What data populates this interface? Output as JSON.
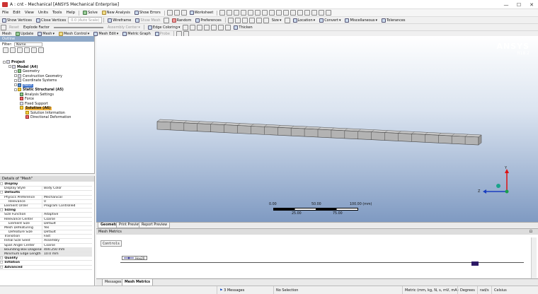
{
  "window": {
    "title": "A : cnt - Mechanical [ANSYS Mechanical Enterprise]",
    "controls": [
      "—",
      "☐",
      "✕"
    ]
  },
  "menu": [
    "File",
    "Edit",
    "View",
    "Units",
    "Tools",
    "Help"
  ],
  "toolbar1": {
    "solve": "Solve",
    "new_analysis": "New Analysis",
    "show_errors": "Show Errors",
    "worksheet": "Worksheet"
  },
  "toolbar2": {
    "show_vertices": "Show Vertices",
    "close_vertices": "Close Vertices",
    "auto_scale": "0.0 (Auto Scale)",
    "wireframe": "Wireframe",
    "show_mesh": "Show Mesh",
    "random": "Random",
    "preferences": "Preferences",
    "size": "Size",
    "location": "Location",
    "convert": "Convert",
    "miscellaneous": "Miscellaneous",
    "tolerances": "Tolerances"
  },
  "toolbar3": {
    "reset": "Reset",
    "explode_factor": "Explode Factor",
    "assembly_center": "Assembly Center",
    "edge_coloring": "Edge Coloring",
    "thicken": "Thicken"
  },
  "toolbar4": {
    "mesh_tab": "Mesh",
    "update": "Update",
    "mesh": "Mesh",
    "mesh_control": "Mesh Control",
    "mesh_edit": "Mesh Edit",
    "metric_graph": "Metric Graph",
    "probe": "Probe"
  },
  "outline": {
    "title": "Outline",
    "filter_label": "Filter:",
    "filter_value": "Name",
    "tree": [
      {
        "label": "Project",
        "level": 0,
        "icon": "project-icon",
        "bold": true
      },
      {
        "label": "Model (A4)",
        "level": 1,
        "icon": "model-icon",
        "bold": true
      },
      {
        "label": "Geometry",
        "level": 2,
        "icon": "geometry-icon",
        "bold": false
      },
      {
        "label": "Construction Geometry",
        "level": 2,
        "icon": "construction-geometry-icon",
        "bold": false
      },
      {
        "label": "Coordinate Systems",
        "level": 2,
        "icon": "coordinate-systems-icon",
        "bold": false
      },
      {
        "label": "Mesh",
        "level": 2,
        "icon": "mesh-icon",
        "bold": false,
        "selected": true
      },
      {
        "label": "Static Structural (A5)",
        "level": 2,
        "icon": "static-structural-icon",
        "bold": true
      },
      {
        "label": "Analysis Settings",
        "level": 3,
        "icon": "analysis-settings-icon",
        "bold": false
      },
      {
        "label": "Force",
        "level": 3,
        "icon": "force-icon",
        "bold": false
      },
      {
        "label": "Fixed Support",
        "level": 3,
        "icon": "fixed-support-icon",
        "bold": false
      },
      {
        "label": "Solution (A6)",
        "level": 3,
        "icon": "solution-icon",
        "bold": true,
        "highlight": true
      },
      {
        "label": "Solution Information",
        "level": 4,
        "icon": "solution-information-icon",
        "bold": false
      },
      {
        "label": "Directional Deformation",
        "level": 4,
        "icon": "directional-deformation-icon",
        "bold": false
      }
    ]
  },
  "details": {
    "title": "Details of \"Mesh\"",
    "rows": [
      {
        "k": "Display",
        "v": "",
        "type": "sec"
      },
      {
        "k": "Display Style",
        "v": "Body Color",
        "type": ""
      },
      {
        "k": "Defaults",
        "v": "",
        "type": "sec"
      },
      {
        "k": "Physics Preference",
        "v": "Mechanical",
        "type": ""
      },
      {
        "k": "Relevance",
        "v": "0",
        "type": "ind"
      },
      {
        "k": "Element Order",
        "v": "Program Controlled",
        "type": ""
      },
      {
        "k": "Sizing",
        "v": "",
        "type": "sec"
      },
      {
        "k": "Size Function",
        "v": "Adaptive",
        "type": ""
      },
      {
        "k": "Relevance Center",
        "v": "Coarse",
        "type": ""
      },
      {
        "k": "Element Size",
        "v": "Default",
        "type": "ind"
      },
      {
        "k": "Mesh Defeaturing",
        "v": "Yes",
        "type": ""
      },
      {
        "k": "Defeature Size",
        "v": "Default",
        "type": "ind"
      },
      {
        "k": "Transition",
        "v": "Fast",
        "type": ""
      },
      {
        "k": "Initial Size Seed",
        "v": "Assembly",
        "type": ""
      },
      {
        "k": "Span Angle Center",
        "v": "Coarse",
        "type": ""
      },
      {
        "k": "Bounding Box Diagonal",
        "v": "400.250 mm",
        "type": "hl"
      },
      {
        "k": "Minimum Edge Length",
        "v": "10.0 mm",
        "type": "hl"
      },
      {
        "k": "Quality",
        "v": "",
        "type": "sec"
      },
      {
        "k": "Inflation",
        "v": "",
        "type": "sec"
      },
      {
        "k": "Advanced",
        "v": "",
        "type": "sec"
      }
    ]
  },
  "viewport": {
    "logo": "ANSYS",
    "version": "R18.2",
    "scale": {
      "top": [
        "0.00",
        "50.00",
        "100.00 (mm)"
      ],
      "bottom": [
        "25.00",
        "75.00"
      ]
    },
    "axes": {
      "z": "Z",
      "y": "Y"
    }
  },
  "view_tabs": [
    "Geometry",
    "Print Preview",
    "Report Preview"
  ],
  "mesh_metrics": {
    "title": "Mesh Metrics",
    "controls": "Controls",
    "legend": "Hex20"
  },
  "bottom_tabs": [
    "Messages",
    "Mesh Metrics"
  ],
  "status": {
    "messages": "3 Messages",
    "selection": "No Selection",
    "units": "Metric (mm, kg, N, s, mV, mA)",
    "angle": "Degrees",
    "rate": "rad/s",
    "temp": "Celsius"
  }
}
